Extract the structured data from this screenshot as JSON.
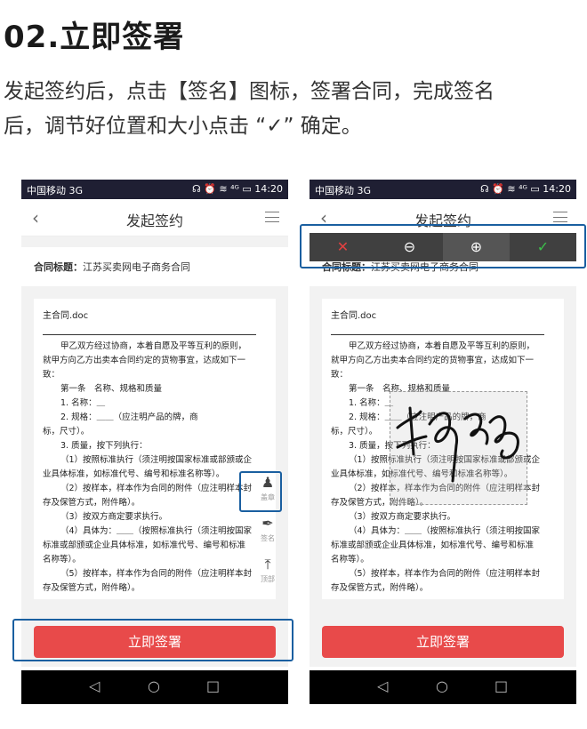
{
  "step": {
    "title": "02.立即签署",
    "desc_line1": "发起签约后，点击【签名】图标，签署合同，完成签名",
    "desc_line2": "后，调节好位置和大小点击 “✓” 确定。"
  },
  "status_bar": {
    "carrier": "中国移动 3G",
    "icons": "☊ ⏰ ≋ ⁴ᴳ ▭ 14:20",
    "time": "14:20"
  },
  "nav": {
    "back_icon": "back-arrow-icon",
    "title": "发起签约",
    "menu_icon": "menu-icon"
  },
  "contract": {
    "label": "合同标题：",
    "value": "江苏买卖网电子商务合同"
  },
  "document": {
    "filename": "主合同.doc",
    "lines": [
      "甲乙双方经过协商，本着自愿及平等互利的原则，",
      "就甲方向乙方出卖本合同约定的货物事宜，达成如下一",
      "致：",
      "第一条　名称、规格和质量",
      "1. 名称：＿",
      "2. 规格：＿＿（应注明产品的牌，商",
      "标，尺寸）。",
      "3. 质量，按下列执行：",
      "（1）按照标准执行（须注明按国家标准或部颁或企",
      "业具体标准，如标准代号、编号和标准名称等）。",
      "（2）按样本，样本作为合同的附件（应注明样本封",
      "存及保管方式，附件略）。",
      "（3）按双方商定要求执行。",
      "（4）具体为：＿＿（按照标准执行（须注明按国家",
      "标准或部颁或企业具体标准，如标准代号、编号和标准",
      "名称等）。",
      "（5）按样本，样本作为合同的附件（应注明样本封",
      "存及保管方式，附件略）。"
    ]
  },
  "side_tools": [
    {
      "icon": "stamp-icon",
      "label": "盖章"
    },
    {
      "icon": "pen-icon",
      "label": "签名"
    },
    {
      "icon": "to-top-icon",
      "label": "顶部"
    }
  ],
  "sign_button": "立即签署",
  "android_nav": {
    "back": "◁",
    "home": "○",
    "recent": "□"
  },
  "sign_toolbar": {
    "close": "✕",
    "zoom_out": "⊖",
    "zoom_in": "⊕",
    "confirm": "✓"
  },
  "colors": {
    "accent_red": "#e84a4a",
    "highlight_blue": "#1a5fa0",
    "statusbar": "#1f1f33",
    "confirm_green": "#3cc04a"
  }
}
